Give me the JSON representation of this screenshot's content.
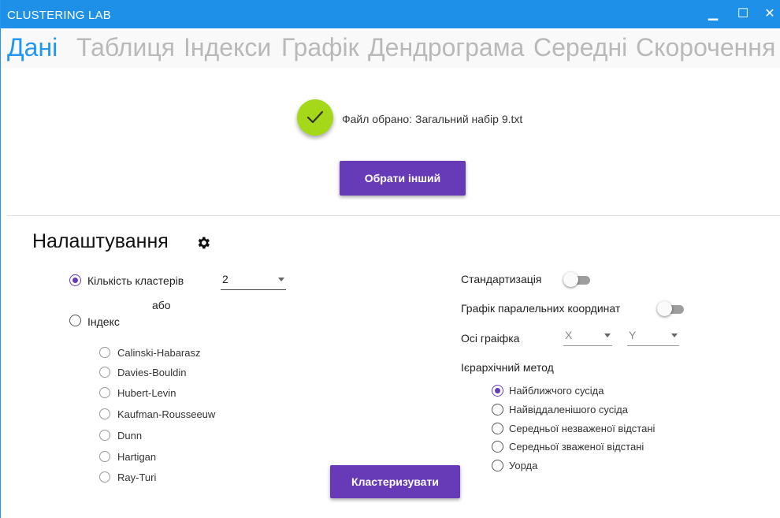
{
  "window": {
    "title": "CLUSTERING LAB",
    "controls": {
      "minimize": "▁",
      "maximize": "☐",
      "close": "✕"
    }
  },
  "tabs": [
    {
      "label": "Дані",
      "active": true
    },
    {
      "label": "Таблиця",
      "active": false
    },
    {
      "label": "Індекси",
      "active": false
    },
    {
      "label": "Графік",
      "active": false
    },
    {
      "label": "Дендрограма",
      "active": false
    },
    {
      "label": "Середні",
      "active": false
    },
    {
      "label": "Скорочення",
      "active": false
    }
  ],
  "file": {
    "status_text": "Файл обрано: Загальний набір 9.txt",
    "choose_other_label": "Обрати інший",
    "status_icon": "check-icon",
    "status_color": "#a6d81a"
  },
  "settings": {
    "title": "Налаштування",
    "icon": "gear-icon",
    "clusters_count_label": "Кількість кластерів",
    "clusters_count_value": "2",
    "or_label": "або",
    "index_label": "Індекс",
    "indices": [
      "Calinski-Habarasz",
      "Davies-Bouldin",
      "Hubert-Levin",
      "Kaufman-Rousseeuw",
      "Dunn",
      "Hartigan",
      "Ray-Turi"
    ],
    "standardization_label": "Стандартизація",
    "standardization_on": false,
    "parallel_coords_label": "Графік паралельних координат",
    "parallel_coords_on": false,
    "axes_label": "Осі граіфка",
    "axis_x_value": "X",
    "axis_y_value": "Y",
    "hier_method_label": "Ієрархічний метод",
    "hier_methods": [
      "Найближчого сусіда",
      "Найвіддаленішого сусіда",
      "Середньої незваженої відстані",
      "Середньої зваженої відстані",
      "Уорда"
    ],
    "hier_selected": 0,
    "cluster_button_label": "Кластеризувати"
  },
  "colors": {
    "accent": "#673ab7",
    "titlebar": "#1e90e8",
    "tab_active": "#2196f3",
    "tab_inactive": "#b9b9b9"
  }
}
